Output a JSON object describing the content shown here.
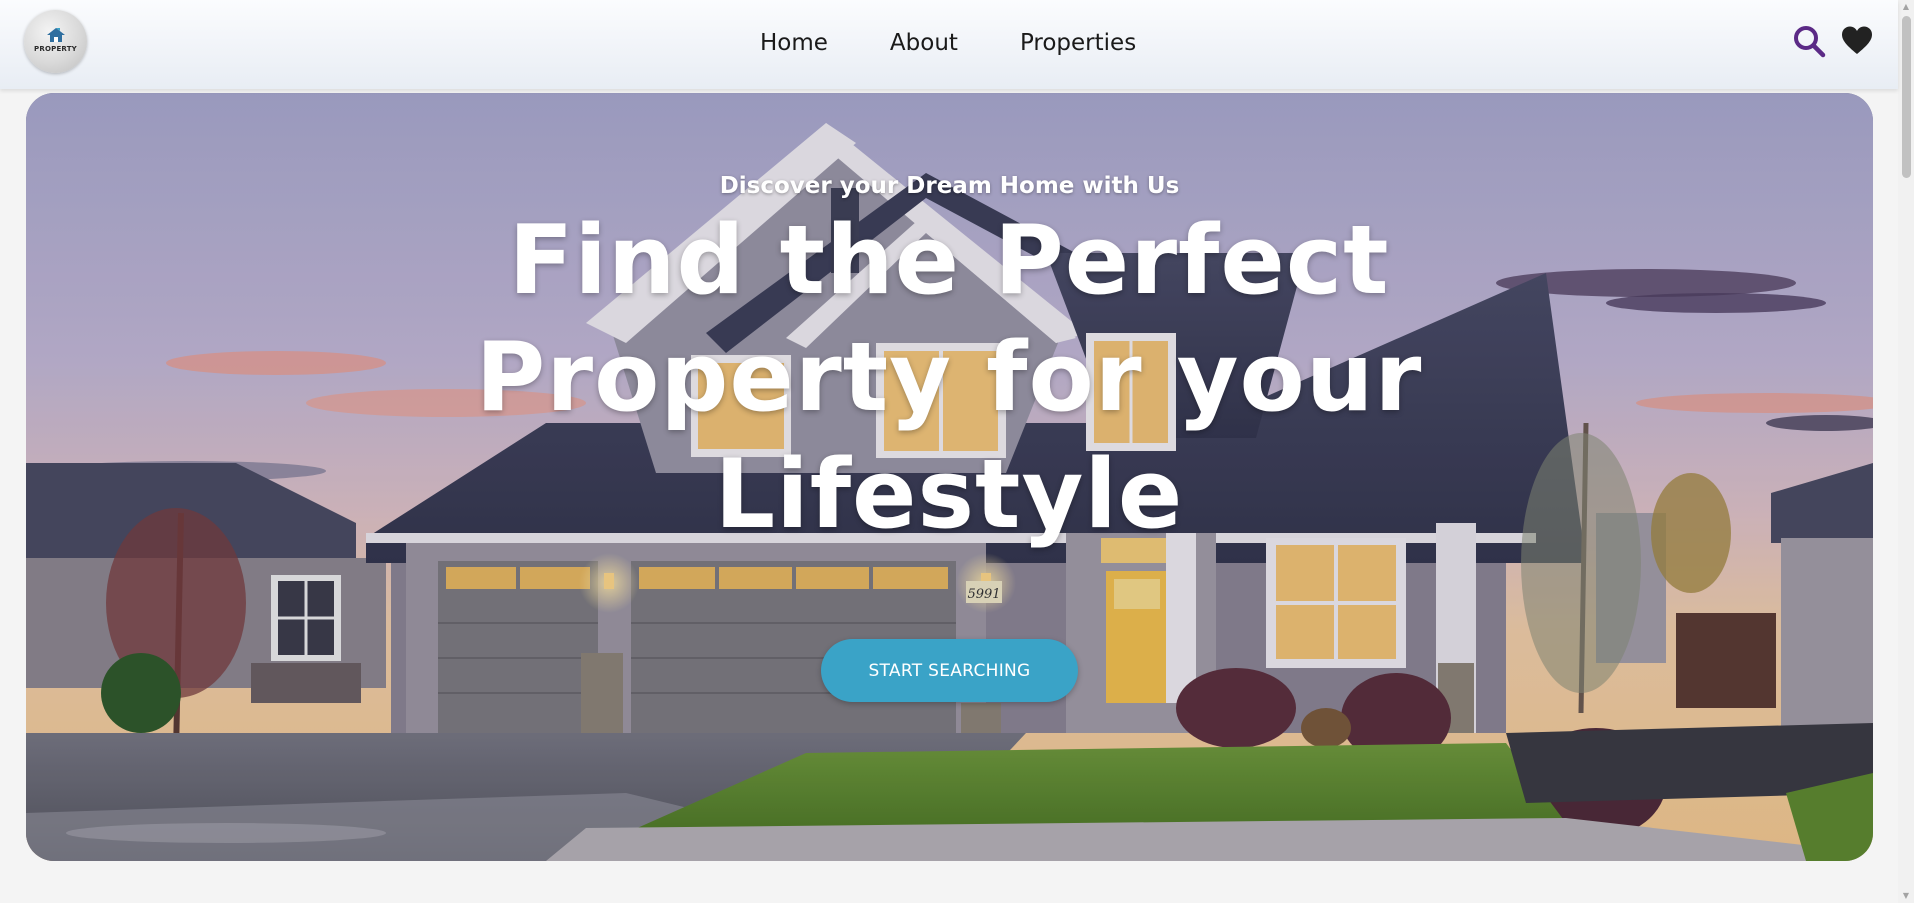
{
  "brand": {
    "logo_text": "PROPERTY"
  },
  "nav": {
    "items": [
      {
        "label": "Home"
      },
      {
        "label": "About"
      },
      {
        "label": "Properties"
      }
    ]
  },
  "header_icons": {
    "search": "search-icon",
    "favorites": "heart-icon"
  },
  "hero": {
    "eyebrow": "Discover your Dream Home with Us",
    "headline": "Find the Perfect Property for your Lifestyle",
    "cta_label": "START SEARCHING",
    "house_number": "5991"
  },
  "colors": {
    "accent": "#3aa3c7",
    "search_icon": "#5b2a86",
    "heart_icon": "#222222"
  }
}
